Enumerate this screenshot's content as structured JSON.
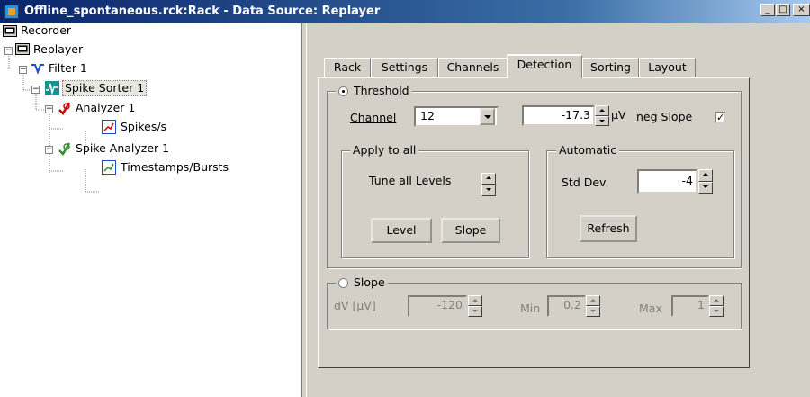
{
  "window": {
    "title": "Offline_spontaneous.rck:Rack - Data Source: Replayer",
    "controls": {
      "minimize": "_",
      "maximize": "□",
      "close": "×"
    }
  },
  "tree": {
    "recorder": "Recorder",
    "replayer": "Replayer",
    "filter": "Filter 1",
    "spike_sorter": "Spike Sorter 1",
    "analyzer": "Analyzer 1",
    "spikes": "Spikes/s",
    "spike_analyzer": "Spike Analyzer 1",
    "timestamps": "Timestamps/Bursts",
    "expand_minus": "−"
  },
  "tabs": [
    "Rack",
    "Settings",
    "Channels",
    "Detection",
    "Sorting",
    "Layout"
  ],
  "threshold": {
    "legend": "Threshold",
    "channel_label": "Channel",
    "channel_value": "12",
    "level_value": "-17.3",
    "unit": "µV",
    "neg_slope_label": "neg Slope",
    "neg_slope_checked": "✓"
  },
  "apply_to_all": {
    "legend": "Apply to all",
    "tune_label": "Tune all Levels",
    "level_button": "Level",
    "slope_button": "Slope"
  },
  "automatic": {
    "legend": "Automatic",
    "std_label": "Std Dev",
    "std_value": "-4",
    "refresh_button": "Refresh"
  },
  "slope": {
    "legend": "Slope",
    "dv_label": "dV [µV]",
    "dv_value": "-120",
    "min_label": "Min",
    "min_value": "0.2",
    "max_label": "Max",
    "max_value": "1"
  }
}
